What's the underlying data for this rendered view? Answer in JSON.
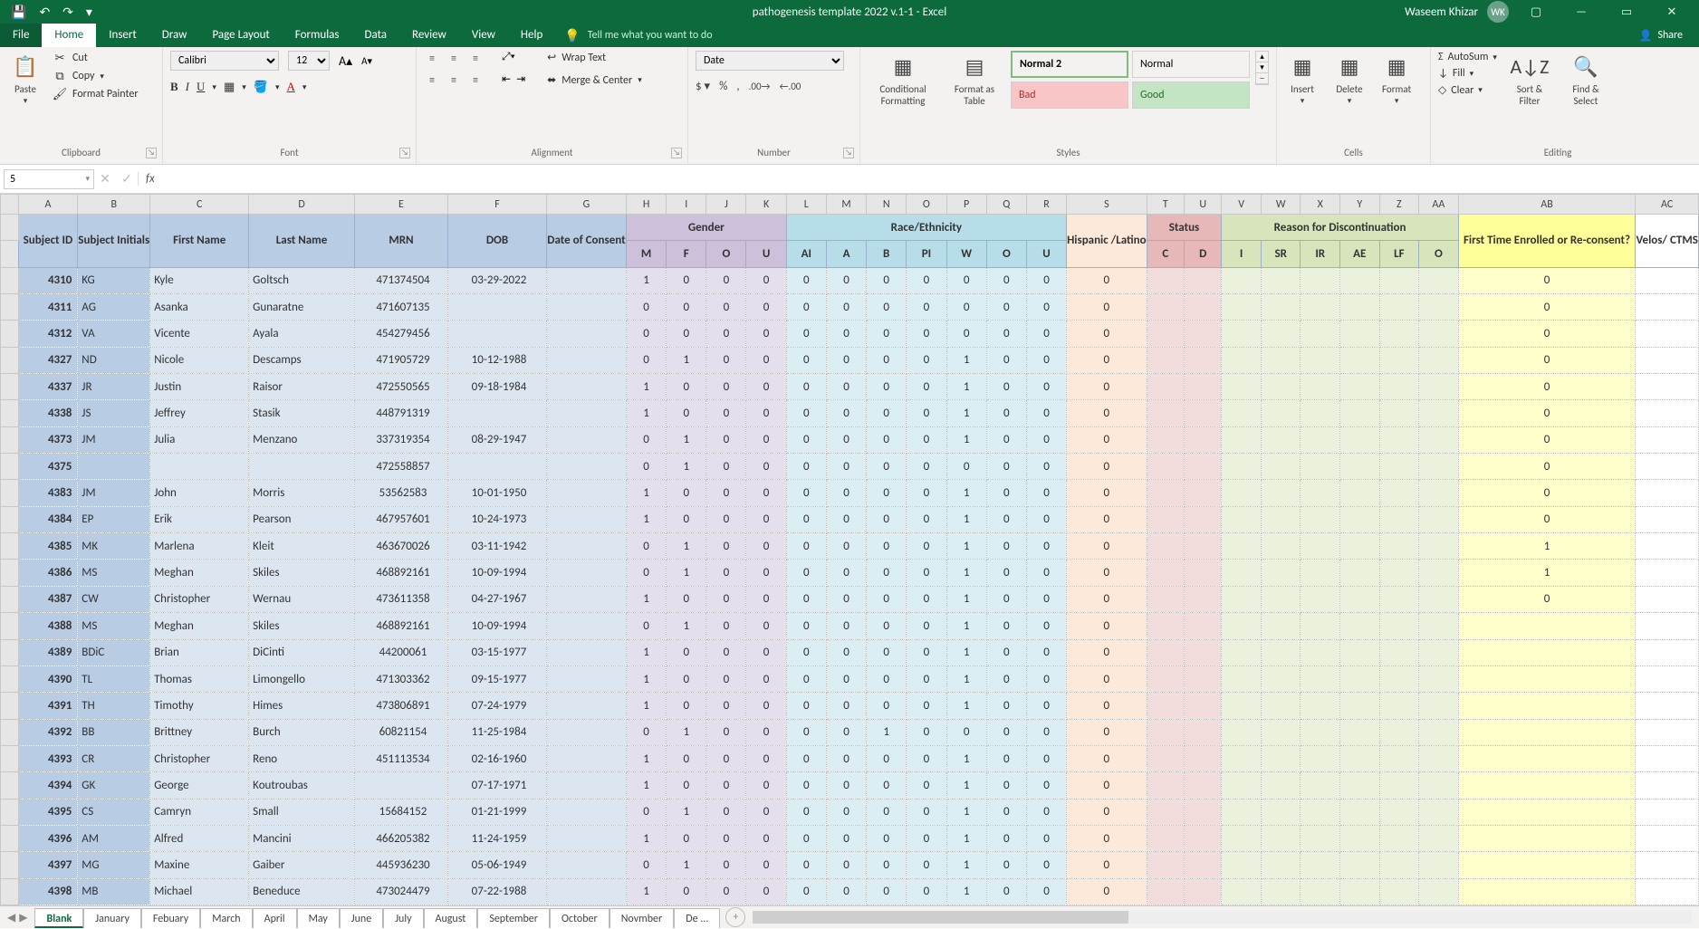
{
  "titlebar": {
    "doc_title": "pathogenesis template 2022 v.1-1  -  Excel",
    "user_name": "Waseem Khizar",
    "user_initials": "WK"
  },
  "tabs": {
    "file": "File",
    "home": "Home",
    "insert": "Insert",
    "draw": "Draw",
    "page_layout": "Page Layout",
    "formulas": "Formulas",
    "data": "Data",
    "review": "Review",
    "view": "View",
    "help": "Help",
    "tell_me": "Tell me what you want to do",
    "share": "Share"
  },
  "ribbon": {
    "clipboard": {
      "paste": "Paste",
      "cut": "Cut",
      "copy": "Copy",
      "format_painter": "Format Painter",
      "label": "Clipboard"
    },
    "font": {
      "name": "Calibri",
      "size": "12",
      "label": "Font"
    },
    "alignment": {
      "wrap": "Wrap Text",
      "merge": "Merge & Center",
      "label": "Alignment"
    },
    "number": {
      "format": "Date",
      "label": "Number"
    },
    "styles": {
      "cond_fmt": "Conditional Formatting",
      "fmt_table": "Format as Table",
      "normal2": "Normal 2",
      "normal": "Normal",
      "bad": "Bad",
      "good": "Good",
      "label": "Styles"
    },
    "cells": {
      "insert": "Insert",
      "delete": "Delete",
      "format": "Format",
      "label": "Cells"
    },
    "editing": {
      "autosum": "AutoSum",
      "fill": "Fill",
      "clear": "Clear",
      "sort": "Sort & Filter",
      "find": "Find & Select",
      "label": "Editing"
    }
  },
  "namebox": "5",
  "col_letters": [
    "A",
    "B",
    "C",
    "D",
    "E",
    "F",
    "G",
    "H",
    "I",
    "J",
    "K",
    "L",
    "M",
    "N",
    "O",
    "P",
    "Q",
    "R",
    "S",
    "T",
    "U",
    "V",
    "W",
    "X",
    "Y",
    "Z",
    "AA",
    "AB",
    "AC"
  ],
  "headers": {
    "subject_id": "Subject ID",
    "subject_initials": "Subject Initials",
    "first_name": "First Name",
    "last_name": "Last Name",
    "mrn": "MRN",
    "dob": "DOB",
    "doc": "Date of Consent",
    "gender": "Gender",
    "gender_sub": [
      "M",
      "F",
      "O",
      "U"
    ],
    "race": "Race/Ethnicity",
    "race_sub": [
      "AI",
      "A",
      "B",
      "PI",
      "W",
      "O",
      "U"
    ],
    "hispanic": "Hispanic /Latino",
    "status": "Status",
    "status_sub": [
      "C",
      "D"
    ],
    "rfd": "Reason for Discontinuation",
    "rfd_sub": [
      "I",
      "SR",
      "IR",
      "AE",
      "LF",
      "O"
    ],
    "fte": "First Time Enrolled or Re-consent?",
    "velos": "Velos/ CTMS"
  },
  "rows": [
    {
      "id": "4310",
      "ini": "KG",
      "fn": "Kyle",
      "ln": "Goltsch",
      "mrn": "471374504",
      "dob": "03-29-2022",
      "g": [
        1,
        0,
        0,
        0
      ],
      "re": [
        0,
        0,
        0,
        0,
        0,
        0,
        0
      ],
      "hl": 0,
      "fte": "0"
    },
    {
      "id": "4311",
      "ini": "AG",
      "fn": "Asanka",
      "ln": "Gunaratne",
      "mrn": "471607135",
      "dob": "",
      "g": [
        0,
        0,
        0,
        0
      ],
      "re": [
        0,
        0,
        0,
        0,
        0,
        0,
        0
      ],
      "hl": 0,
      "fte": "0"
    },
    {
      "id": "4312",
      "ini": "VA",
      "fn": "Vicente",
      "ln": "Ayala",
      "mrn": "454279456",
      "dob": "",
      "g": [
        0,
        0,
        0,
        0
      ],
      "re": [
        0,
        0,
        0,
        0,
        0,
        0,
        0
      ],
      "hl": 0,
      "fte": "0"
    },
    {
      "id": "4327",
      "ini": "ND",
      "fn": "Nicole",
      "ln": "Descamps",
      "mrn": "471905729",
      "dob": "10-12-1988",
      "g": [
        0,
        1,
        0,
        0
      ],
      "re": [
        0,
        0,
        0,
        0,
        1,
        0,
        0
      ],
      "hl": 0,
      "fte": "0"
    },
    {
      "id": "4337",
      "ini": "JR",
      "fn": "Justin",
      "ln": "Raisor",
      "mrn": "472550565",
      "dob": "09-18-1984",
      "g": [
        1,
        0,
        0,
        0
      ],
      "re": [
        0,
        0,
        0,
        0,
        1,
        0,
        0
      ],
      "hl": 0,
      "fte": "0"
    },
    {
      "id": "4338",
      "ini": "JS",
      "fn": "Jeffrey",
      "ln": "Stasik",
      "mrn": "448791319",
      "dob": "",
      "g": [
        1,
        0,
        0,
        0
      ],
      "re": [
        0,
        0,
        0,
        0,
        1,
        0,
        0
      ],
      "hl": 0,
      "fte": "0"
    },
    {
      "id": "4373",
      "ini": "JM",
      "fn": "Julia",
      "ln": "Menzano",
      "mrn": "337319354",
      "dob": "08-29-1947",
      "g": [
        0,
        1,
        0,
        0
      ],
      "re": [
        0,
        0,
        0,
        0,
        1,
        0,
        0
      ],
      "hl": 0,
      "fte": "0"
    },
    {
      "id": "4375",
      "ini": "",
      "fn": "",
      "ln": "",
      "mrn": "472558857",
      "dob": "",
      "g": [
        0,
        1,
        0,
        0
      ],
      "re": [
        0,
        0,
        0,
        0,
        0,
        0,
        0
      ],
      "hl": 0,
      "fte": "0"
    },
    {
      "id": "4383",
      "ini": "JM",
      "fn": "John",
      "ln": "Morris",
      "mrn": "53562583",
      "dob": "10-01-1950",
      "g": [
        1,
        0,
        0,
        0
      ],
      "re": [
        0,
        0,
        0,
        0,
        1,
        0,
        0
      ],
      "hl": 0,
      "fte": "0"
    },
    {
      "id": "4384",
      "ini": "EP",
      "fn": "Erik",
      "ln": "Pearson",
      "mrn": "467957601",
      "dob": "10-24-1973",
      "g": [
        1,
        0,
        0,
        0
      ],
      "re": [
        0,
        0,
        0,
        0,
        1,
        0,
        0
      ],
      "hl": 0,
      "fte": "0"
    },
    {
      "id": "4385",
      "ini": "MK",
      "fn": "Marlena",
      "ln": "Kleit",
      "mrn": "463670026",
      "dob": "03-11-1942",
      "g": [
        0,
        1,
        0,
        0
      ],
      "re": [
        0,
        0,
        0,
        0,
        1,
        0,
        0
      ],
      "hl": 0,
      "fte": "1"
    },
    {
      "id": "4386",
      "ini": "MS",
      "fn": "Meghan",
      "ln": "Skiles",
      "mrn": "468892161",
      "dob": "10-09-1994",
      "g": [
        0,
        1,
        0,
        0
      ],
      "re": [
        0,
        0,
        0,
        0,
        1,
        0,
        0
      ],
      "hl": 0,
      "fte": "1"
    },
    {
      "id": "4387",
      "ini": "CW",
      "fn": "Christopher",
      "ln": "Wernau",
      "mrn": "473611358",
      "dob": "04-27-1967",
      "g": [
        1,
        0,
        0,
        0
      ],
      "re": [
        0,
        0,
        0,
        0,
        1,
        0,
        0
      ],
      "hl": 0,
      "fte": "0"
    },
    {
      "id": "4388",
      "ini": "MS",
      "fn": "Meghan",
      "ln": "Skiles",
      "mrn": "468892161",
      "dob": "10-09-1994",
      "g": [
        0,
        1,
        0,
        0
      ],
      "re": [
        0,
        0,
        0,
        0,
        1,
        0,
        0
      ],
      "hl": 0,
      "fte": ""
    },
    {
      "id": "4389",
      "ini": "BDiC",
      "fn": "Brian",
      "ln": "DiCinti",
      "mrn": "44200061",
      "dob": "03-15-1977",
      "g": [
        1,
        0,
        0,
        0
      ],
      "re": [
        0,
        0,
        0,
        0,
        1,
        0,
        0
      ],
      "hl": 0,
      "fte": ""
    },
    {
      "id": "4390",
      "ini": "TL",
      "fn": "Thomas",
      "ln": "Limongello",
      "mrn": "471303362",
      "dob": "09-15-1977",
      "g": [
        1,
        0,
        0,
        0
      ],
      "re": [
        0,
        0,
        0,
        0,
        1,
        0,
        0
      ],
      "hl": 0,
      "fte": ""
    },
    {
      "id": "4391",
      "ini": "TH",
      "fn": "Timothy",
      "ln": "Himes",
      "mrn": "473806891",
      "dob": "07-24-1979",
      "g": [
        1,
        0,
        0,
        0
      ],
      "re": [
        0,
        0,
        0,
        0,
        1,
        0,
        0
      ],
      "hl": 0,
      "fte": ""
    },
    {
      "id": "4392",
      "ini": "BB",
      "fn": "Brittney",
      "ln": "Burch",
      "mrn": "60821154",
      "dob": "11-25-1984",
      "g": [
        0,
        1,
        0,
        0
      ],
      "re": [
        0,
        0,
        1,
        0,
        0,
        0,
        0
      ],
      "hl": 0,
      "fte": ""
    },
    {
      "id": "4393",
      "ini": "CR",
      "fn": "Christopher",
      "ln": "Reno",
      "mrn": "451113534",
      "dob": "02-16-1960",
      "g": [
        1,
        0,
        0,
        0
      ],
      "re": [
        0,
        0,
        0,
        0,
        1,
        0,
        0
      ],
      "hl": 0,
      "fte": ""
    },
    {
      "id": "4394",
      "ini": "GK",
      "fn": "George",
      "ln": "Koutroubas",
      "mrn": "",
      "dob": "07-17-1971",
      "g": [
        1,
        0,
        0,
        0
      ],
      "re": [
        0,
        0,
        0,
        0,
        1,
        0,
        0
      ],
      "hl": 0,
      "fte": ""
    },
    {
      "id": "4395",
      "ini": "CS",
      "fn": "Camryn",
      "ln": "Small",
      "mrn": "15684152",
      "dob": "01-21-1999",
      "g": [
        0,
        1,
        0,
        0
      ],
      "re": [
        0,
        0,
        0,
        0,
        1,
        0,
        0
      ],
      "hl": 0,
      "fte": ""
    },
    {
      "id": "4396",
      "ini": "AM",
      "fn": "Alfred",
      "ln": "Mancini",
      "mrn": "466205382",
      "dob": "11-24-1959",
      "g": [
        1,
        0,
        0,
        0
      ],
      "re": [
        0,
        0,
        0,
        0,
        1,
        0,
        0
      ],
      "hl": 0,
      "fte": ""
    },
    {
      "id": "4397",
      "ini": "MG",
      "fn": "Maxine",
      "ln": "Gaiber",
      "mrn": "445936230",
      "dob": "05-06-1949",
      "g": [
        0,
        1,
        0,
        0
      ],
      "re": [
        0,
        0,
        0,
        0,
        1,
        0,
        0
      ],
      "hl": 0,
      "fte": ""
    },
    {
      "id": "4398",
      "ini": "MB",
      "fn": "Michael",
      "ln": "Beneduce",
      "mrn": "473024479",
      "dob": "07-22-1988",
      "g": [
        1,
        0,
        0,
        0
      ],
      "re": [
        0,
        0,
        0,
        0,
        1,
        0,
        0
      ],
      "hl": 0,
      "fte": ""
    }
  ],
  "sheet_tabs": [
    "Blank",
    "January",
    "Febuary",
    "March",
    "April",
    "May",
    "June",
    "July",
    "August",
    "September",
    "October",
    "Novmber",
    "De ..."
  ],
  "active_sheet": "Blank"
}
